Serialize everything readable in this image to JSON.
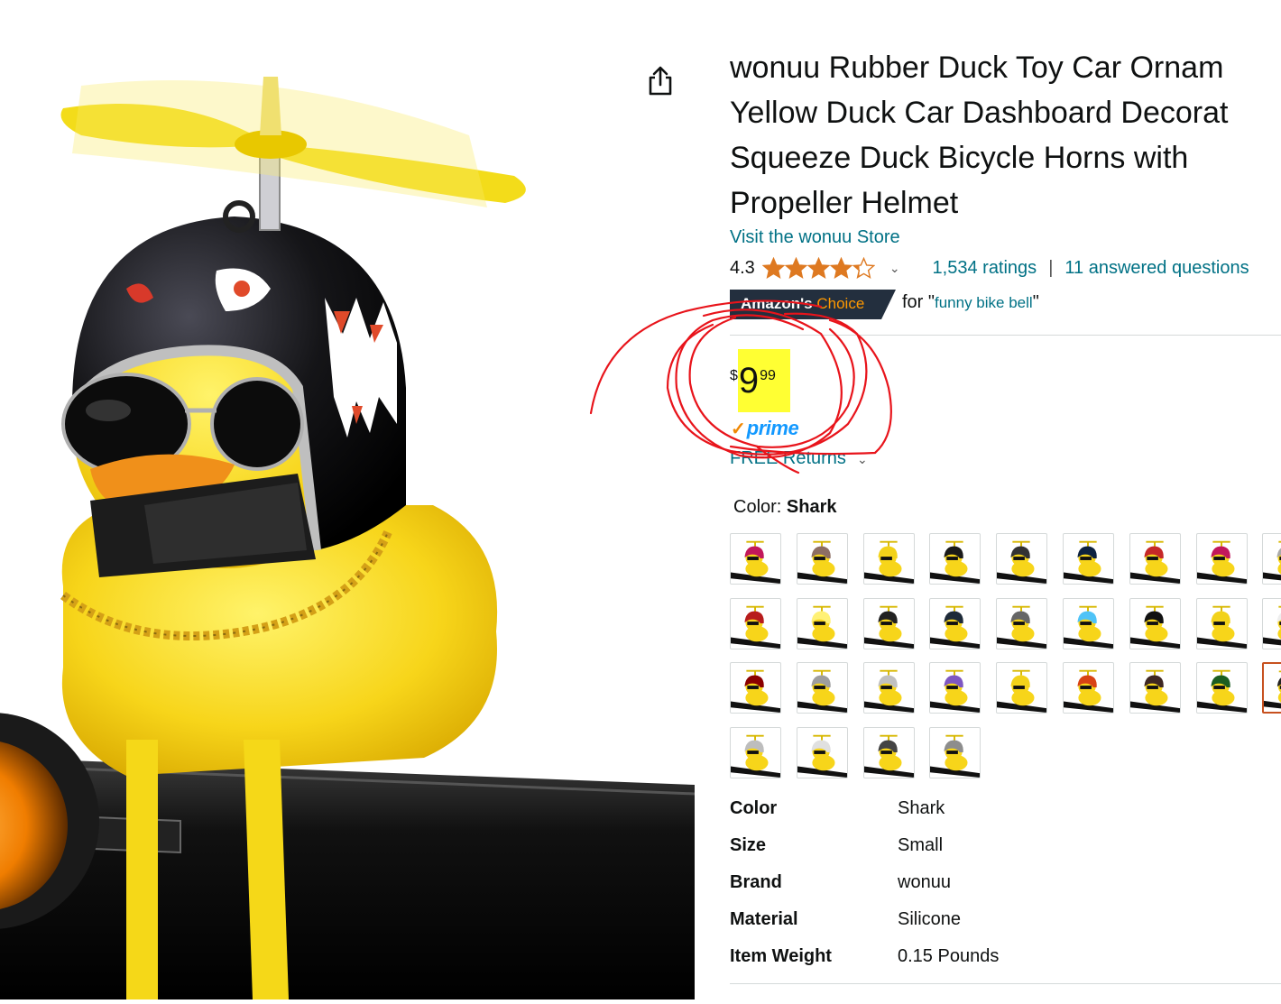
{
  "product": {
    "title_lines": [
      "wonuu Rubber Duck Toy Car Ornam",
      "Yellow Duck Car Dashboard Decorat",
      "Squeeze Duck Bicycle Horns with",
      "Propeller Helmet"
    ],
    "store_link": "Visit the wonuu Store",
    "image_icon": "rubber-duck-helmet-photo"
  },
  "share": {
    "icon": "share-icon"
  },
  "rating": {
    "value": "4.3",
    "stars": 4.3,
    "chevron": "⌄",
    "ratings_count": "1,534 ratings",
    "separator": "|",
    "answered": "11 answered questions"
  },
  "choice": {
    "badge_white": "Amazon's",
    "badge_orange": "Choice",
    "for_text": "for \"",
    "keyword": "funny bike bell",
    "close_quote": "\""
  },
  "price": {
    "symbol": "$",
    "whole": "9",
    "fraction": "99",
    "highlight_color": "#ffff33"
  },
  "prime": {
    "check": "✓",
    "label": "prime"
  },
  "returns": {
    "label": "FREE Returns",
    "chevron": "⌄"
  },
  "annotation": {
    "color": "#e8141b",
    "icon": "red-pen-circles"
  },
  "color_selector": {
    "label": "Color: ",
    "selected": "Shark",
    "swatch_count_visible": 31,
    "selected_index": 26
  },
  "specs": [
    {
      "label": "Color",
      "value": "Shark"
    },
    {
      "label": "Size",
      "value": "Small"
    },
    {
      "label": "Brand",
      "value": "wonuu"
    },
    {
      "label": "Material",
      "value": "Silicone"
    },
    {
      "label": "Item Weight",
      "value": "0.15 Pounds"
    }
  ],
  "colors": {
    "link": "#007185",
    "prime_blue": "#1399ff",
    "star": "#de7921",
    "badge_bg": "#232f3e",
    "accent_orange": "#ff9900"
  }
}
